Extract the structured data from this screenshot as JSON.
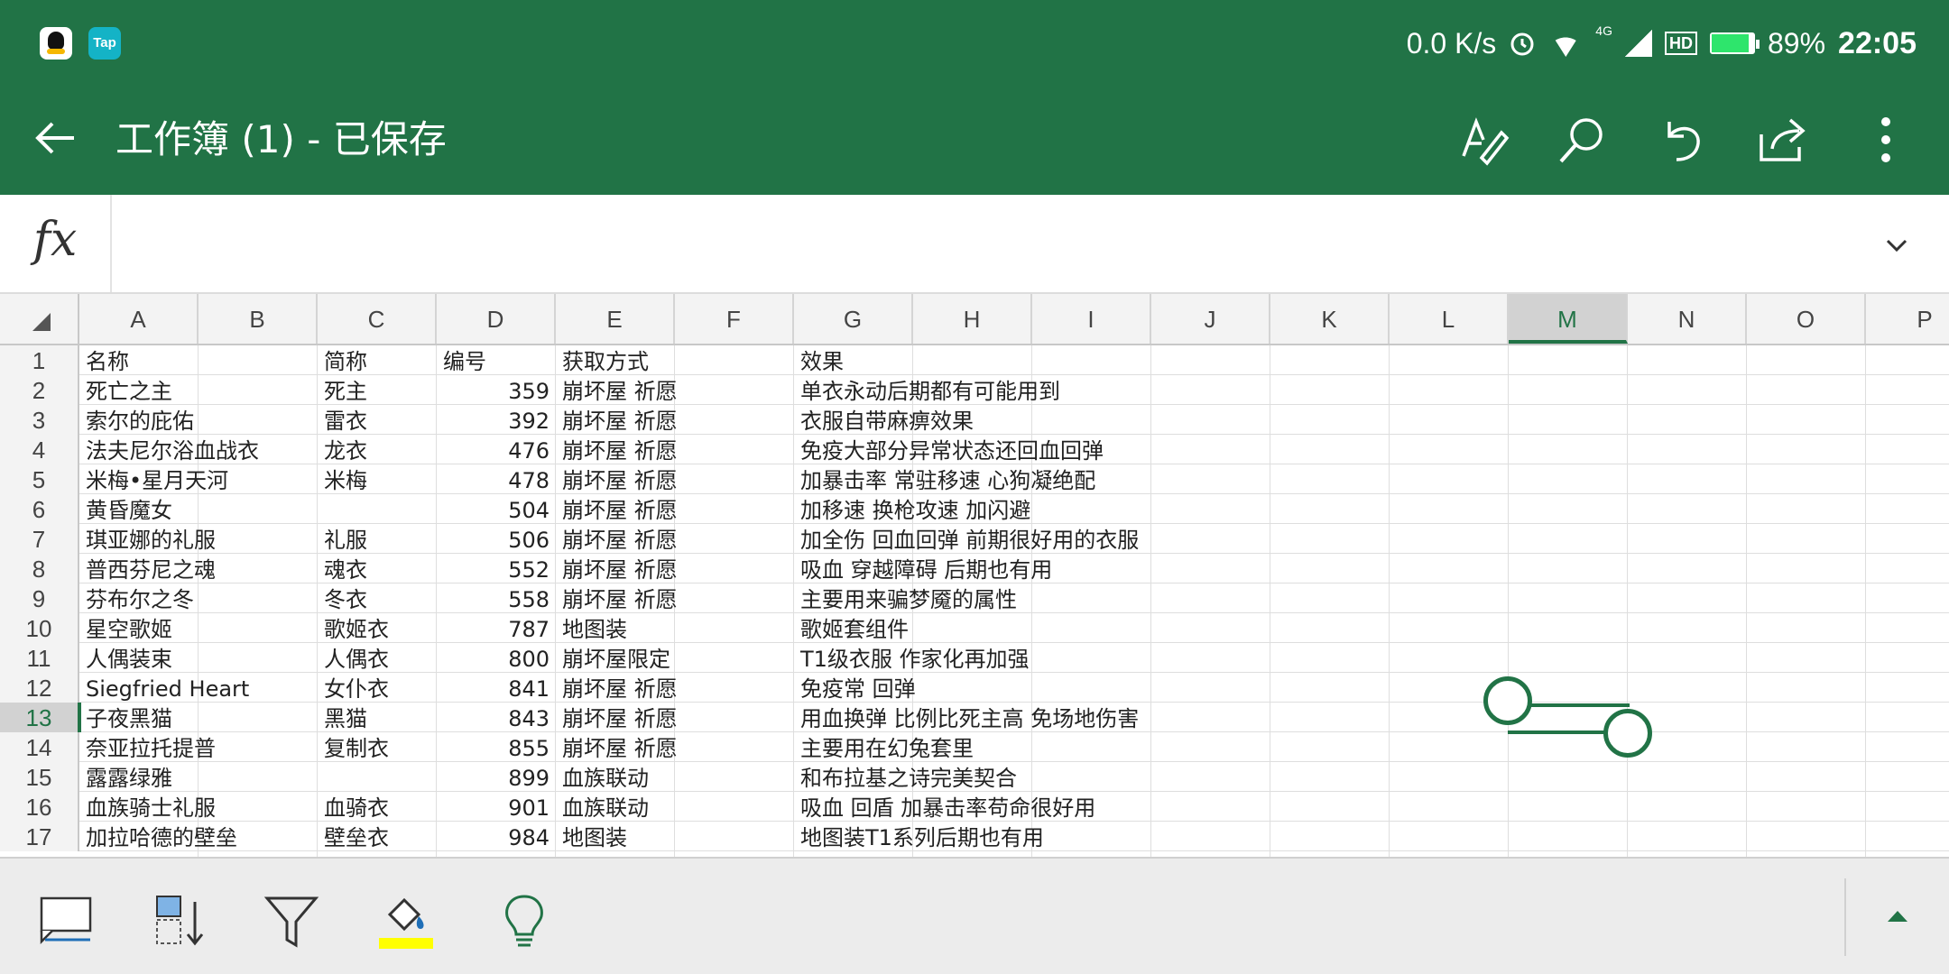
{
  "status_bar": {
    "net_speed": "0.0 K/s",
    "network_type": "4G",
    "hd_label": "HD",
    "battery_percent": "89%",
    "battery_level": 0.89,
    "time": "22:05",
    "apps": [
      {
        "name": "qq",
        "icon": "qq-penguin-icon"
      },
      {
        "name": "tap",
        "label": "Tap",
        "icon": "taptap-icon"
      }
    ]
  },
  "titlebar": {
    "title": "工作簿 (1) - 已保存",
    "actions": [
      "draw-pen-icon",
      "search-icon",
      "undo-icon",
      "share-icon",
      "more-vertical-icon"
    ]
  },
  "formula_bar": {
    "fx_label": "fx",
    "value": ""
  },
  "colors": {
    "accent": "#217346",
    "header_bg": "#f3f3f3",
    "selected_header_bg": "#d2d2d2",
    "fill_color_swatch": "#ffff00"
  },
  "sheet": {
    "columns": [
      "A",
      "B",
      "C",
      "D",
      "E",
      "F",
      "G",
      "H",
      "I",
      "J",
      "K",
      "L",
      "M",
      "N",
      "O",
      "P"
    ],
    "selected_column": "M",
    "selected_row": "13",
    "row_numbers": [
      "1",
      "2",
      "3",
      "4",
      "5",
      "6",
      "7",
      "8",
      "9",
      "10",
      "11",
      "12",
      "13",
      "14",
      "15",
      "16",
      "17"
    ],
    "rows": [
      {
        "A": "名称",
        "C": "简称",
        "D": "编号",
        "E": "获取方式",
        "G": "效果"
      },
      {
        "A": "死亡之主",
        "C": "死主",
        "D": "359",
        "E": "崩坏屋 祈愿",
        "G": "单衣永动后期都有可能用到"
      },
      {
        "A": "索尔的庇佑",
        "C": "雷衣",
        "D": "392",
        "E": "崩坏屋 祈愿",
        "G": "衣服自带麻痹效果"
      },
      {
        "A": "法夫尼尔浴血战衣",
        "C": "龙衣",
        "D": "476",
        "E": "崩坏屋 祈愿",
        "G": "免疫大部分异常状态还回血回弹"
      },
      {
        "A": "米梅•星月天河",
        "C": "米梅",
        "D": "478",
        "E": "崩坏屋 祈愿",
        "G": "加暴击率 常驻移速 心狗凝绝配"
      },
      {
        "A": "黄昏魔女",
        "C": "",
        "D": "504",
        "E": "崩坏屋 祈愿",
        "G": "加移速 换枪攻速 加闪避"
      },
      {
        "A": "琪亚娜的礼服",
        "C": "礼服",
        "D": "506",
        "E": "崩坏屋 祈愿",
        "G": "加全伤 回血回弹 前期很好用的衣服"
      },
      {
        "A": "普西芬尼之魂",
        "C": "魂衣",
        "D": "552",
        "E": "崩坏屋 祈愿",
        "G": "吸血 穿越障碍 后期也有用"
      },
      {
        "A": "芬布尔之冬",
        "C": "冬衣",
        "D": "558",
        "E": "崩坏屋 祈愿",
        "G": "主要用来骗梦魇的属性"
      },
      {
        "A": "星空歌姬",
        "C": "歌姬衣",
        "D": "787",
        "E": "地图装",
        "G": "歌姬套组件"
      },
      {
        "A": "人偶装束",
        "C": "人偶衣",
        "D": "800",
        "E": "崩坏屋限定",
        "G": "T1级衣服 作家化再加强"
      },
      {
        "A": "Siegfried Heart",
        "C": "女仆衣",
        "D": "841",
        "E": "崩坏屋 祈愿",
        "G": "免疫常 回弹"
      },
      {
        "A": "子夜黑猫",
        "C": "黑猫",
        "D": "843",
        "E": "崩坏屋 祈愿",
        "G": "用血换弹 比例比死主高 免场地伤害"
      },
      {
        "A": "奈亚拉托提普",
        "C": "复制衣",
        "D": "855",
        "E": "崩坏屋 祈愿",
        "G": "主要用在幻兔套里"
      },
      {
        "A": "露露绿雅",
        "C": "",
        "D": "899",
        "E": "血族联动",
        "G": "和布拉基之诗完美契合"
      },
      {
        "A": "血族骑士礼服",
        "C": "血骑衣",
        "D": "901",
        "E": "血族联动",
        "G": "吸血 回盾 加暴击率苟命很好用"
      },
      {
        "A": "加拉哈德的壁垒",
        "C": "壁垒衣",
        "D": "984",
        "E": "地图装",
        "G": "地图装T1系列后期也有用"
      }
    ]
  },
  "bottom_toolbar": {
    "tools": [
      "comment-icon",
      "sort-icon",
      "filter-icon",
      "fill-color-icon",
      "lightbulb-icon"
    ],
    "collapse": "chevron-up-icon"
  }
}
